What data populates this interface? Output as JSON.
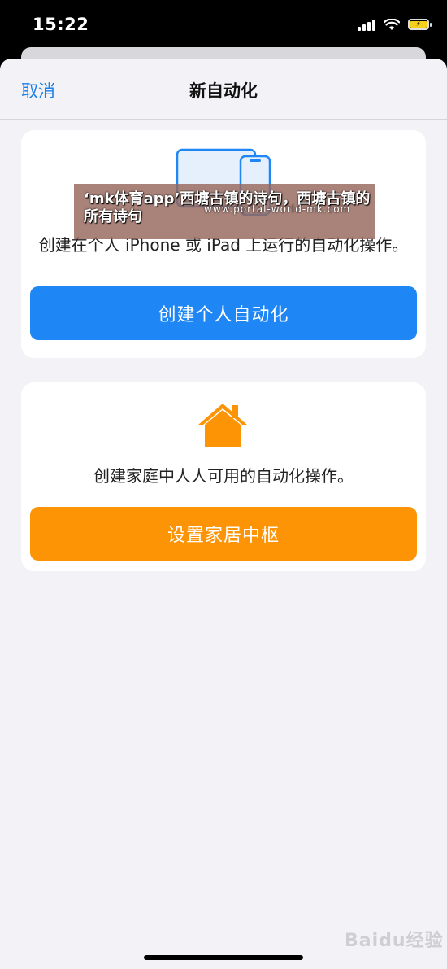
{
  "status_bar": {
    "time": "15:22"
  },
  "nav": {
    "cancel_label": "取消",
    "title": "新自动化"
  },
  "personal_card": {
    "description": "创建在个人 iPhone 或 iPad 上运行的自动化操作。",
    "button_label": "创建个人自动化",
    "button_color": "#1e86f5"
  },
  "home_card": {
    "description": "创建家庭中人人可用的自动化操作。",
    "button_label": "设置家居中枢",
    "button_color": "#fd9405",
    "icon_color": "#fd9405"
  },
  "overlay": {
    "text": "‘mk体育app’西塘古镇的诗句，西塘古镇的所有诗句",
    "url": "www.portal-world-mk.com"
  },
  "watermark": {
    "text": "Baidu经验"
  },
  "colors": {
    "accent": "#1a7fe8",
    "sheet_background": "#f2f2f7"
  }
}
